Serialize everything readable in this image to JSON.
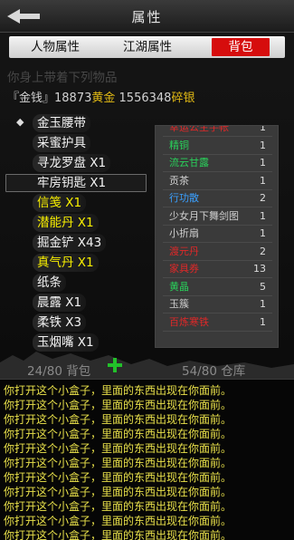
{
  "header": {
    "title": "属性"
  },
  "tabs": [
    {
      "label": "人物属性",
      "active": false
    },
    {
      "label": "江湖属性",
      "active": false
    },
    {
      "label": "背包",
      "active": true
    }
  ],
  "carry_heading": "你身上带着下列物品",
  "money": {
    "prefix": "『金钱』",
    "gold": "18873",
    "gold_unit": "黄金",
    "silver": "1556348",
    "silver_unit": "碎银"
  },
  "bag_items": [
    {
      "label": "金玉腰带",
      "color": "white",
      "pointer": true
    },
    {
      "label": "采蜜护具",
      "color": "white"
    },
    {
      "label": "寻龙罗盘 X1",
      "color": "white"
    },
    {
      "label": "牢房钥匙 X1",
      "color": "white",
      "selected": true
    },
    {
      "label": "信笺 X1",
      "color": "yellow"
    },
    {
      "label": "潜能丹 X1",
      "color": "yellow"
    },
    {
      "label": "掘金铲 X43",
      "color": "white"
    },
    {
      "label": "真气丹 X1",
      "color": "yellow"
    },
    {
      "label": "纸条",
      "color": "white"
    },
    {
      "label": "晨露 X1",
      "color": "white"
    },
    {
      "label": "柔铁 X3",
      "color": "white"
    },
    {
      "label": "玉烟嘴 X1",
      "color": "white"
    }
  ],
  "warehouse_items": [
    {
      "name": "幸运公主手帐",
      "qty": "1",
      "color": "#e02828",
      "partial": true
    },
    {
      "name": "精铜",
      "qty": "1",
      "color": "#29d05a"
    },
    {
      "name": "流云甘露",
      "qty": "1",
      "color": "#29d05a"
    },
    {
      "name": "贡茶",
      "qty": "1",
      "color": "#cfcfcf"
    },
    {
      "name": "行功散",
      "qty": "2",
      "color": "#3aa0ff"
    },
    {
      "name": "少女月下舞剑图",
      "qty": "1",
      "color": "#cfcfcf"
    },
    {
      "name": "小折扇",
      "qty": "1",
      "color": "#cfcfcf"
    },
    {
      "name": "渡元丹",
      "qty": "2",
      "color": "#e02828"
    },
    {
      "name": "家具券",
      "qty": "13",
      "color": "#e02828"
    },
    {
      "name": "黄晶",
      "qty": "5",
      "color": "#29d05a"
    },
    {
      "name": "玉簇",
      "qty": "1",
      "color": "#cfcfcf"
    },
    {
      "name": "百炼寒铁",
      "qty": "1",
      "color": "#e02828"
    }
  ],
  "counters": {
    "bag": "24/80 背包",
    "warehouse": "54/80 仓库"
  },
  "log": {
    "lines": [
      "你打开这个小盒子，里面的东西出现在你面前。",
      "你打开这个小盒子，里面的东西出现在你面前。",
      "你打开这个小盒子，里面的东西出现在你面前。",
      "你打开这个小盒子，里面的东西出现在你面前。",
      "你打开这个小盒子，里面的东西出现在你面前。",
      "你打开这个小盒子，里面的东西出现在你面前。",
      "你打开这个小盒子，里面的东西出现在你面前。",
      "你打开这个小盒子，里面的东西出现在你面前。",
      "你打开这个小盒子，里面的东西出现在你面前。",
      "你打开这个小盒子，里面的东西出现在你面前。",
      "你打开这个小盒子，里面的东西出现在你面前。"
    ]
  },
  "colors": {
    "accent_red": "#d60d0d",
    "gold": "#e2ba14",
    "yellow_item": "#f7ee00",
    "log_text": "#e8e04a"
  }
}
